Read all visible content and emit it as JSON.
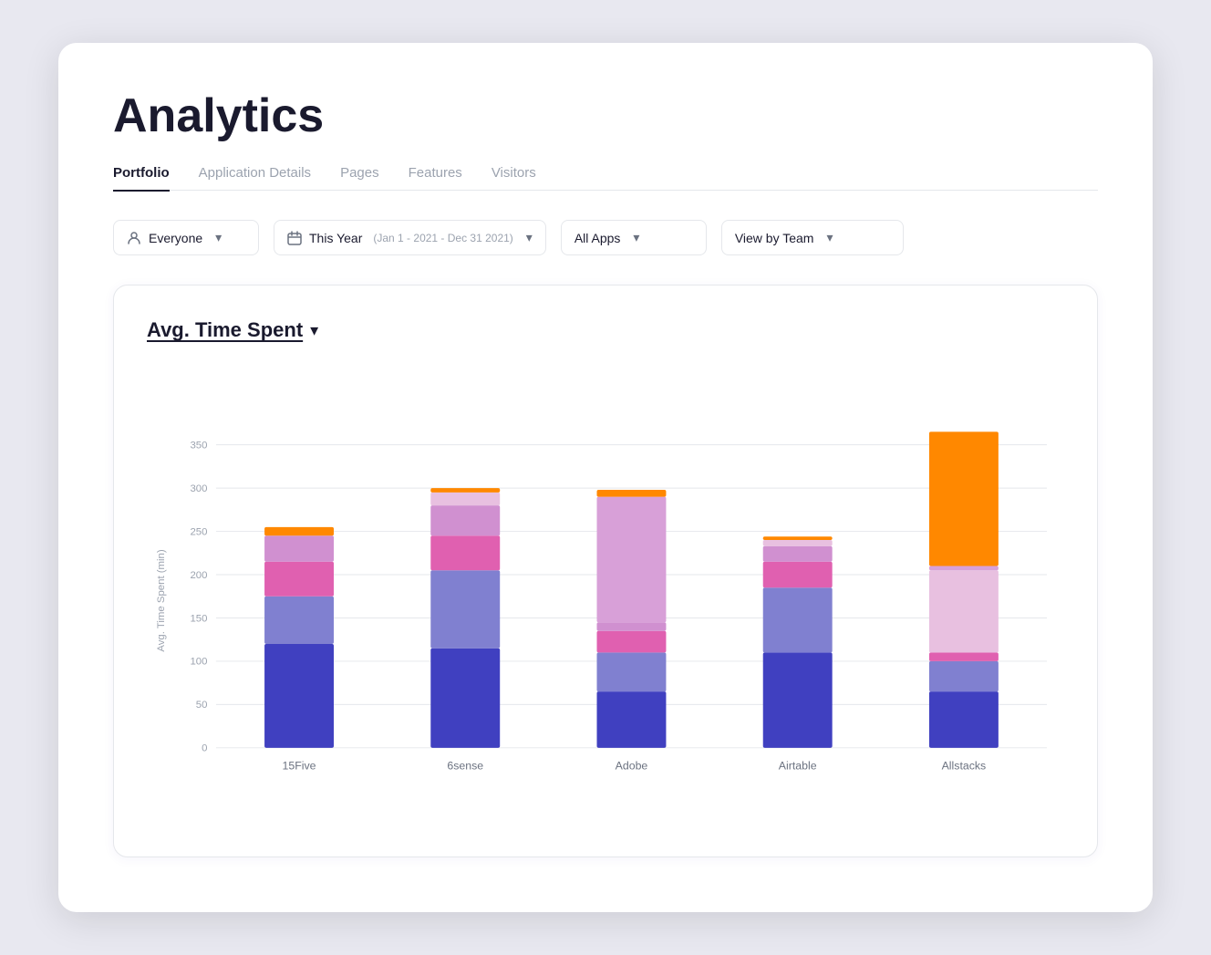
{
  "page": {
    "title": "Analytics",
    "tabs": [
      {
        "id": "portfolio",
        "label": "Portfolio",
        "active": true
      },
      {
        "id": "app-details",
        "label": "Application Details",
        "active": false
      },
      {
        "id": "pages",
        "label": "Pages",
        "active": false
      },
      {
        "id": "features",
        "label": "Features",
        "active": false
      },
      {
        "id": "visitors",
        "label": "Visitors",
        "active": false
      }
    ]
  },
  "filters": {
    "everyone": {
      "label": "Everyone",
      "chevron": "▾"
    },
    "date": {
      "label": "This Year",
      "sub": "(Jan 1 - 2021 - Dec 31 2021)",
      "chevron": "▾"
    },
    "apps": {
      "label": "All Apps",
      "chevron": "▾"
    },
    "team": {
      "label": "View by Team",
      "chevron": "▾"
    }
  },
  "chart": {
    "title": "Avg. Time Spent",
    "chevron": "▾",
    "y_axis_label": "Avg. Time Spent (min)",
    "y_ticks": [
      0,
      50,
      100,
      150,
      200,
      250,
      300,
      350
    ],
    "bars": [
      {
        "label": "15Five",
        "segments": [
          {
            "value": 120,
            "color": "#4040c0"
          },
          {
            "value": 55,
            "color": "#8080d0"
          },
          {
            "value": 40,
            "color": "#e060b0"
          },
          {
            "value": 30,
            "color": "#d090d0"
          },
          {
            "value": 10,
            "color": "#ff8800"
          }
        ],
        "total": 255
      },
      {
        "label": "6sense",
        "segments": [
          {
            "value": 115,
            "color": "#4040c0"
          },
          {
            "value": 90,
            "color": "#8080d0"
          },
          {
            "value": 40,
            "color": "#e060b0"
          },
          {
            "value": 35,
            "color": "#d090d0"
          },
          {
            "value": 15,
            "color": "#e8c0e0"
          },
          {
            "value": 5,
            "color": "#ff8800"
          }
        ],
        "total": 300
      },
      {
        "label": "Adobe",
        "segments": [
          {
            "value": 65,
            "color": "#4040c0"
          },
          {
            "value": 45,
            "color": "#8080d0"
          },
          {
            "value": 25,
            "color": "#e060b0"
          },
          {
            "value": 10,
            "color": "#d090d0"
          },
          {
            "value": 145,
            "color": "#d8a0d8"
          },
          {
            "value": 8,
            "color": "#ff8800"
          }
        ],
        "total": 298
      },
      {
        "label": "Airtable",
        "segments": [
          {
            "value": 110,
            "color": "#4040c0"
          },
          {
            "value": 75,
            "color": "#8080d0"
          },
          {
            "value": 30,
            "color": "#e060b0"
          },
          {
            "value": 18,
            "color": "#d090d0"
          },
          {
            "value": 7,
            "color": "#e8c0e0"
          },
          {
            "value": 4,
            "color": "#ff8800"
          }
        ],
        "total": 244
      },
      {
        "label": "Allstacks",
        "segments": [
          {
            "value": 65,
            "color": "#4040c0"
          },
          {
            "value": 35,
            "color": "#8080d0"
          },
          {
            "value": 10,
            "color": "#e060b0"
          },
          {
            "value": 95,
            "color": "#e8c0e0"
          },
          {
            "value": 5,
            "color": "#d8a0d8"
          },
          {
            "value": 155,
            "color": "#ff8800"
          }
        ],
        "total": 365
      }
    ],
    "colors": {
      "blue_dark": "#4040c0",
      "blue_light": "#8080d0",
      "pink_dark": "#e060b0",
      "pink_light": "#d090d0",
      "lavender": "#e8c0e0",
      "orange": "#ff8800"
    }
  }
}
